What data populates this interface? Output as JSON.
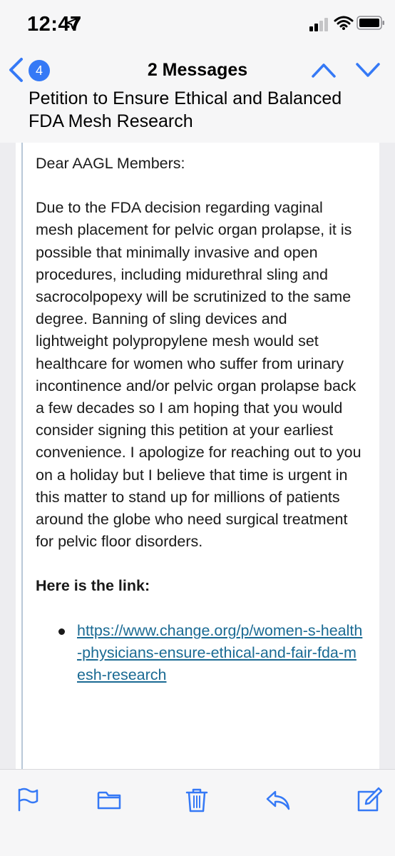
{
  "status_bar": {
    "time": "12:47"
  },
  "nav": {
    "badge_count": "4",
    "title": "2 Messages",
    "subject": "Petition to Ensure Ethical and Balanced FDA Mesh Research"
  },
  "message": {
    "greeting": "Dear AAGL Members:",
    "paragraph": "Due to the FDA decision regarding vaginal mesh placement for pelvic organ prolapse, it is possible that minimally invasive and open procedures, including midurethral sling and sacrocolpopexy will be scrutinized to the same degree. Banning of sling devices and lightweight polypropylene mesh would set healthcare for women who suffer from urinary incontinence and/or pelvic organ prolapse back a few decades so I am hoping that you would consider signing this petition at your earliest convenience. I apologize for reaching out to you on a holiday but I believe that time is urgent in this matter to stand up for millions of patients around the globe who need surgical treatment for pelvic floor disorders.",
    "link_heading": "Here is the link:",
    "link_url": "https://www.change.org/p/women-s-health-physicians-ensure-ethical-and-fair-fda-mesh-research"
  },
  "toolbar": {
    "icons": [
      "flag-icon",
      "folder-icon",
      "trash-icon",
      "reply-icon",
      "compose-icon"
    ]
  },
  "colors": {
    "accent": "#3579f6",
    "link": "#1a6a93",
    "background": "#f6f6f7"
  }
}
